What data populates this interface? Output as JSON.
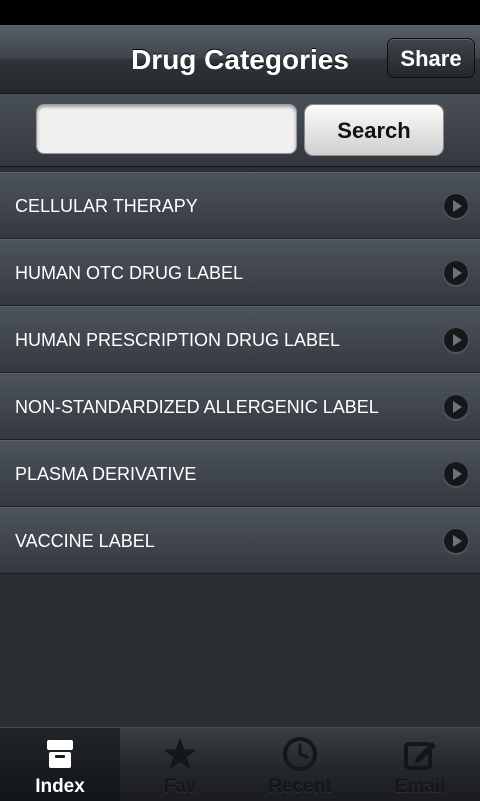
{
  "navbar": {
    "title": "Drug Categories",
    "share_label": "Share"
  },
  "search": {
    "value": "",
    "placeholder": "",
    "button_label": "Search"
  },
  "categories": [
    {
      "label": "CELLULAR THERAPY"
    },
    {
      "label": "HUMAN OTC DRUG LABEL"
    },
    {
      "label": "HUMAN PRESCRIPTION DRUG LABEL"
    },
    {
      "label": "NON-STANDARDIZED ALLERGENIC LABEL"
    },
    {
      "label": "PLASMA DERIVATIVE"
    },
    {
      "label": "VACCINE LABEL"
    }
  ],
  "tabs": [
    {
      "label": "Index",
      "icon": "archive-box-icon",
      "active": true
    },
    {
      "label": "Fav",
      "icon": "star-icon",
      "active": false
    },
    {
      "label": "Recent",
      "icon": "clock-icon",
      "active": false
    },
    {
      "label": "Email",
      "icon": "compose-icon",
      "active": false
    }
  ],
  "colors": {
    "background": "#2b2f34",
    "active_tab_text": "#ffffff",
    "inactive_tab_icon": "#141618"
  }
}
